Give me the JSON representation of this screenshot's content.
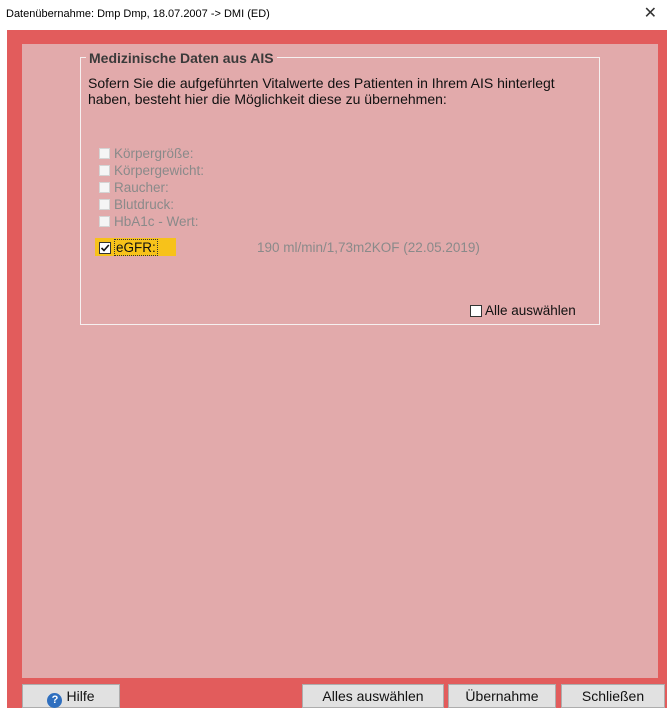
{
  "window": {
    "title": "Datenübernahme: Dmp Dmp, 18.07.2007 -> DMI (ED)",
    "close_icon": "close-icon"
  },
  "group": {
    "title": "Medizinische Daten aus AIS",
    "description": "Sofern Sie die aufgeführten Vitalwerte des Patienten in Ihrem AIS hinterlegt haben, besteht hier die Möglichkeit diese zu übernehmen:"
  },
  "items": [
    {
      "label": "Körpergröße:",
      "checked": false,
      "enabled": false,
      "value": ""
    },
    {
      "label": "Körpergewicht:",
      "checked": false,
      "enabled": false,
      "value": ""
    },
    {
      "label": "Raucher:",
      "checked": false,
      "enabled": false,
      "value": ""
    },
    {
      "label": "Blutdruck:",
      "checked": false,
      "enabled": false,
      "value": ""
    },
    {
      "label": "HbA1c - Wert:",
      "checked": false,
      "enabled": false,
      "value": ""
    },
    {
      "label": "eGFR:",
      "checked": true,
      "enabled": true,
      "value": "190 ml/min/1,73m2KOF (22.05.2019)"
    }
  ],
  "select_all": {
    "label": "Alle auswählen",
    "checked": false
  },
  "buttons": {
    "help": "Hilfe",
    "select_all": "Alles auswählen",
    "apply": "Übernahme",
    "close": "Schließen"
  },
  "colors": {
    "frame": "#e25c5c",
    "panel": "#e2aaab",
    "highlight": "#f7c21a"
  }
}
